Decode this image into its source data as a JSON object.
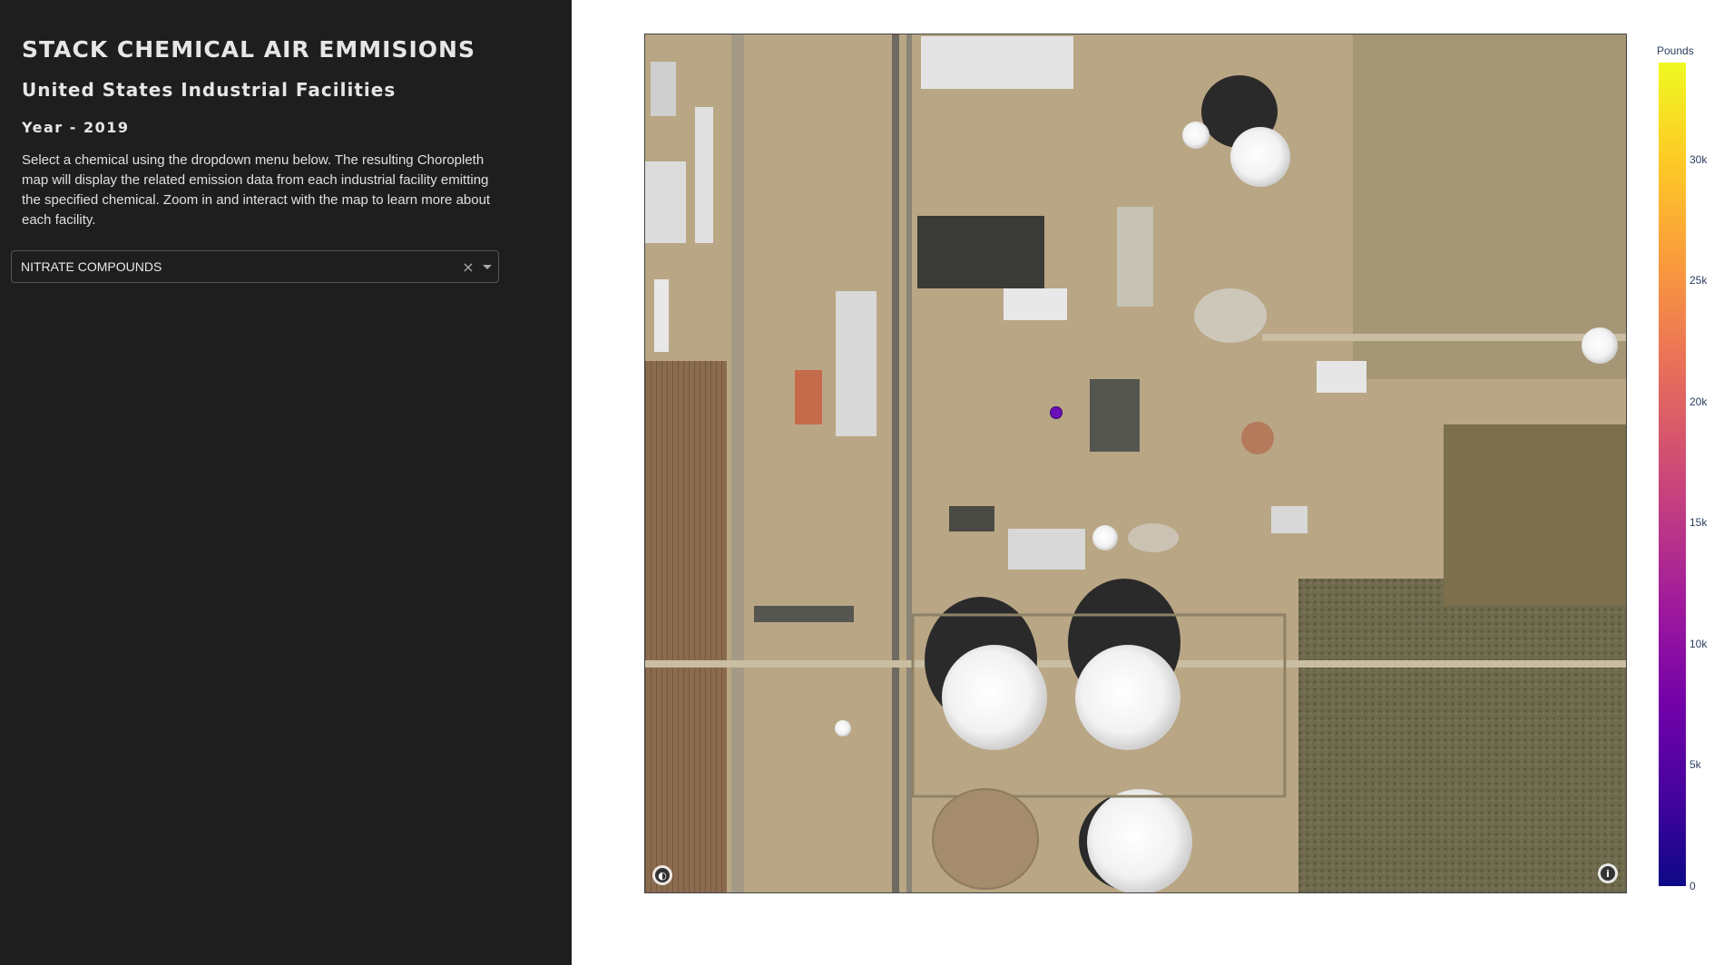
{
  "sidebar": {
    "title": "STACK CHEMICAL AIR EMMISIONS",
    "subtitle": "United States Industrial Facilities",
    "year": "Year - 2019",
    "description": "Select a chemical using the dropdown menu below. The resulting Choropleth map will display the related emission data from each industrial facility emitting the specified chemical. Zoom in and interact with the map to learn more about each facility.",
    "dropdown": {
      "selected": "NITRATE COMPOUNDS",
      "clear_symbol": "×"
    }
  },
  "map": {
    "style": "satellite",
    "facility_points": [
      {
        "emission_pounds": 11000,
        "color": "#6b0fb8"
      }
    ],
    "controls": {
      "logo_icon": "mapbox-logo-icon",
      "info_icon": "info-icon",
      "info_label": "i"
    }
  },
  "colorbar": {
    "title": "Pounds",
    "ticks": [
      "0",
      "5k",
      "10k",
      "15k",
      "20k",
      "25k",
      "30k"
    ],
    "range": [
      0,
      34000
    ],
    "colorscale": "plasma"
  },
  "colors": {
    "sidebar_bg": "#1e1e1e",
    "sidebar_text": "#e6e6e6",
    "axis_text": "#2a3f5f"
  }
}
